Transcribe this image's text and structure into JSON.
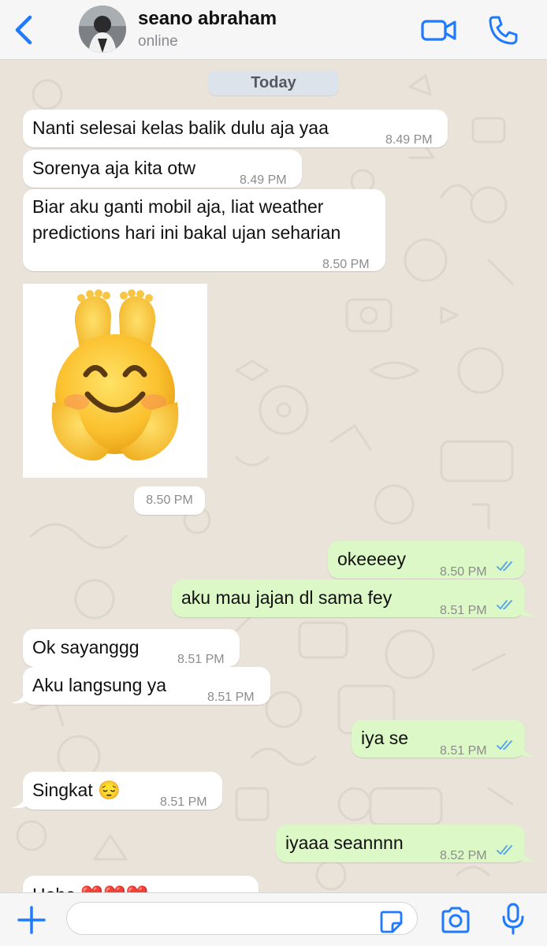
{
  "header": {
    "contact_name": "seano abraham",
    "status": "online",
    "back_icon": "chevron-left-icon",
    "video_icon": "video-camera-icon",
    "call_icon": "phone-icon",
    "accent_color": "#1f7aff"
  },
  "chat": {
    "date_label": "Today",
    "messages": [
      {
        "direction": "in",
        "text": "Nanti selesai kelas balik dulu aja yaa",
        "time": "8.49 PM"
      },
      {
        "direction": "in",
        "text": "Sorenya aja kita otw",
        "time": "8.49 PM"
      },
      {
        "direction": "in",
        "text_line1": "Biar aku ganti mobil aja, liat weather",
        "text_line2": "predictions hari ini bakal ujan seharian",
        "time": "8.50 PM"
      },
      {
        "direction": "in",
        "type": "sticker",
        "sticker": "smiling-face-with-open-hands-and-feet-sticker",
        "time": "8.50 PM"
      },
      {
        "direction": "out",
        "text": "okeeeey",
        "time": "8.50 PM",
        "read": true
      },
      {
        "direction": "out",
        "text": "aku mau jajan dl sama fey",
        "time": "8.51 PM",
        "read": true
      },
      {
        "direction": "in",
        "text": "Ok sayanggg",
        "time": "8.51 PM"
      },
      {
        "direction": "in",
        "text": "Aku langsung ya",
        "time": "8.51 PM"
      },
      {
        "direction": "out",
        "text": "iya se",
        "time": "8.51 PM",
        "read": true
      },
      {
        "direction": "in",
        "text": "Singkat 😔",
        "time": "8.51 PM"
      },
      {
        "direction": "out",
        "text": "iyaaa seannnn",
        "time": "8.52 PM",
        "read": true
      },
      {
        "direction": "in",
        "text": "Hehe ❤️❤️❤️",
        "partial": true
      }
    ],
    "colors": {
      "incoming_bubble": "#ffffff",
      "outgoing_bubble": "#dcf8c6",
      "read_ticks": "#4fa3e8"
    }
  },
  "input_bar": {
    "message_value": "",
    "plus_icon": "plus-icon",
    "sticker_icon": "sticker-icon",
    "camera_icon": "camera-icon",
    "mic_icon": "microphone-icon"
  }
}
